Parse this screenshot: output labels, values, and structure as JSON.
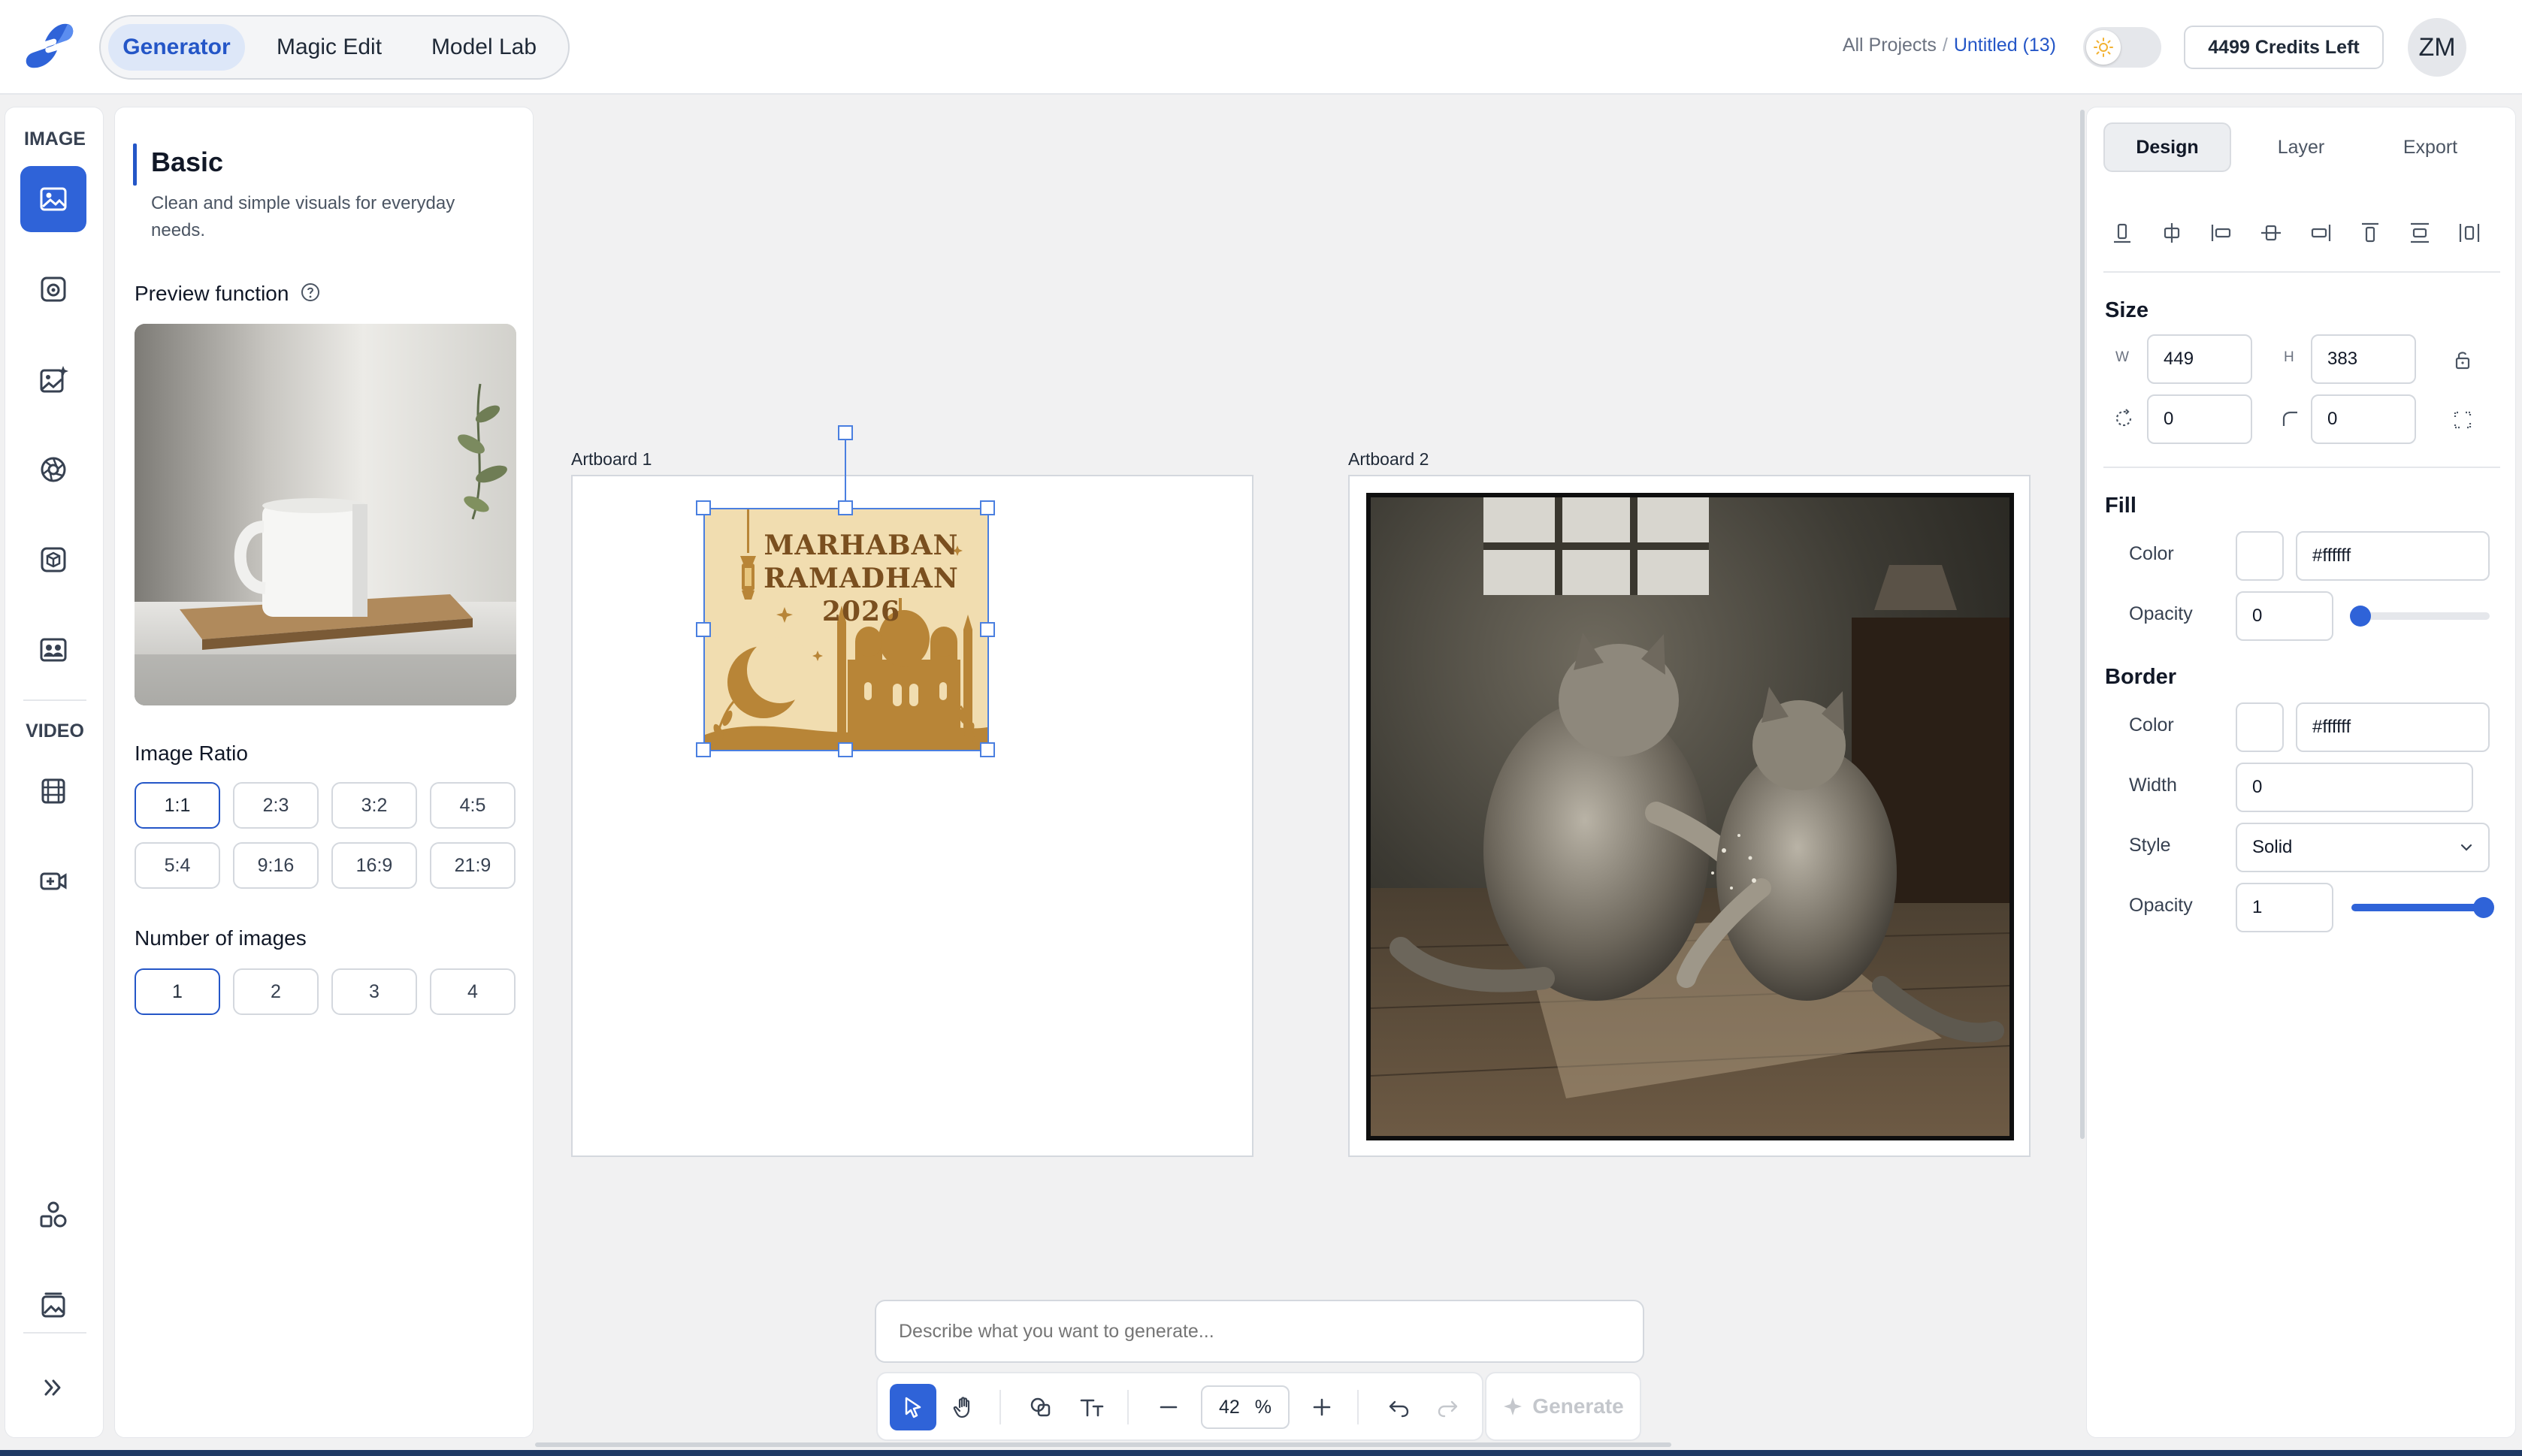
{
  "header": {
    "modes": [
      "Generator",
      "Magic Edit",
      "Model Lab"
    ],
    "active_mode": "Generator",
    "breadcrumb": {
      "root": "All Projects",
      "separator": "/",
      "current": "Untitled (13)"
    },
    "credits": "4499 Credits Left",
    "avatar": "ZM"
  },
  "rail": {
    "image_section": "IMAGE",
    "video_section": "VIDEO",
    "image_tools": [
      "image-icon",
      "camera-icon",
      "image-sparkle-icon",
      "aperture-icon",
      "cube-icon",
      "faces-icon"
    ],
    "video_tools": [
      "film-icon",
      "video-plus-icon"
    ],
    "bottom_tools": [
      "shapes-icon",
      "gallery-icon",
      "expand-icon"
    ]
  },
  "panel": {
    "title": "Basic",
    "description": "Clean and simple visuals for everyday needs.",
    "preview_label": "Preview function",
    "ratio_label": "Image Ratio",
    "ratios": [
      "1:1",
      "2:3",
      "3:2",
      "4:5",
      "5:4",
      "9:16",
      "16:9",
      "21:9"
    ],
    "selected_ratio": "1:1",
    "count_label": "Number of images",
    "counts": [
      "1",
      "2",
      "3",
      "4"
    ],
    "selected_count": "1"
  },
  "canvas": {
    "artboard1_label": "Artboard 1",
    "artboard2_label": "Artboard 2",
    "ramadan_text": {
      "line1": "MARHABAN",
      "line2": "RAMADHAN",
      "line3": "2026"
    }
  },
  "prompt": {
    "placeholder": "Describe what you want to generate..."
  },
  "toolbar": {
    "zoom_value": "42",
    "zoom_unit": "%",
    "generate_label": "Generate"
  },
  "props": {
    "tabs": [
      "Design",
      "Layer",
      "Export"
    ],
    "active_tab": "Design",
    "size": {
      "title": "Size",
      "w_label": "W",
      "w": "449",
      "h_label": "H",
      "h": "383",
      "rotation": "0",
      "radius": "0"
    },
    "fill": {
      "title": "Fill",
      "color_label": "Color",
      "color": "#ffffff",
      "opacity_label": "Opacity",
      "opacity": "0"
    },
    "border": {
      "title": "Border",
      "color_label": "Color",
      "color": "#ffffff",
      "width_label": "Width",
      "width": "0",
      "style_label": "Style",
      "style": "Solid",
      "opacity_label": "Opacity",
      "opacity": "1"
    }
  },
  "colors": {
    "accent": "#2f63d8",
    "accent_text": "#2456c7"
  }
}
